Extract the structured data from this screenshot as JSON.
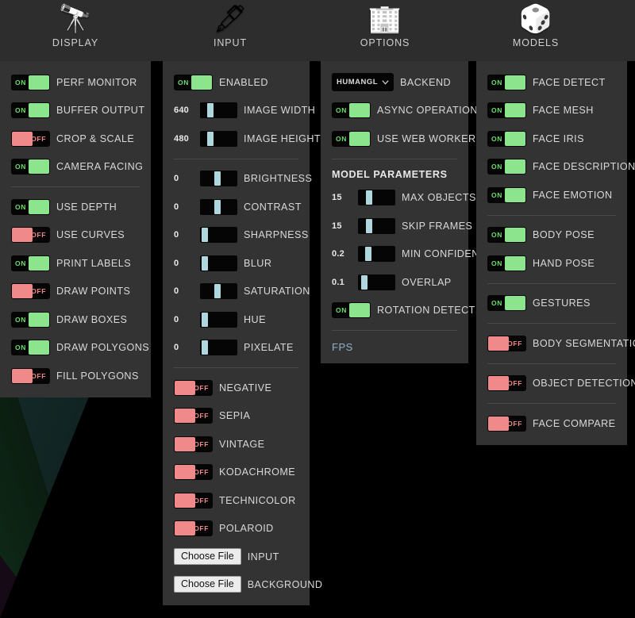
{
  "columns": [
    {
      "id": "display",
      "title": "DISPLAY",
      "icon": "binoculars-icon",
      "icon_glyph": "🔭",
      "rows": [
        {
          "type": "toggle",
          "label": "PERF MONITOR",
          "state": "ON",
          "state_label": "ON"
        },
        {
          "type": "toggle",
          "label": "BUFFER OUTPUT",
          "state": "ON",
          "state_label": "ON"
        },
        {
          "type": "toggle",
          "label": "CROP & SCALE",
          "state": "OFF",
          "state_label": "OFF"
        },
        {
          "type": "toggle",
          "label": "CAMERA FACING",
          "state": "ON",
          "state_label": "ON"
        },
        {
          "type": "divider"
        },
        {
          "type": "toggle",
          "label": "USE DEPTH",
          "state": "ON",
          "state_label": "ON"
        },
        {
          "type": "toggle",
          "label": "USE CURVES",
          "state": "OFF",
          "state_label": "OFF"
        },
        {
          "type": "toggle",
          "label": "PRINT LABELS",
          "state": "ON",
          "state_label": "ON"
        },
        {
          "type": "toggle",
          "label": "DRAW POINTS",
          "state": "OFF",
          "state_label": "OFF"
        },
        {
          "type": "toggle",
          "label": "DRAW BOXES",
          "state": "ON",
          "state_label": "ON"
        },
        {
          "type": "toggle",
          "label": "DRAW POLYGONS",
          "state": "ON",
          "state_label": "ON"
        },
        {
          "type": "toggle",
          "label": "FILL POLYGONS",
          "state": "OFF",
          "state_label": "OFF"
        }
      ]
    },
    {
      "id": "input",
      "title": "INPUT",
      "icon": "knives-icon",
      "icon_glyph": "🖋",
      "rows": [
        {
          "type": "toggle",
          "label": "ENABLED",
          "state": "ON",
          "state_label": "ON"
        },
        {
          "type": "slider",
          "label": "IMAGE WIDTH",
          "value": "640",
          "percent": 22
        },
        {
          "type": "slider",
          "label": "IMAGE HEIGHT",
          "value": "480",
          "percent": 22
        },
        {
          "type": "divider"
        },
        {
          "type": "slider",
          "label": "BRIGHTNESS",
          "value": "0",
          "percent": 47
        },
        {
          "type": "slider",
          "label": "CONTRAST",
          "value": "0",
          "percent": 47
        },
        {
          "type": "slider",
          "label": "SHARPNESS",
          "value": "0",
          "percent": 5
        },
        {
          "type": "slider",
          "label": "BLUR",
          "value": "0",
          "percent": 5
        },
        {
          "type": "slider",
          "label": "SATURATION",
          "value": "0",
          "percent": 47
        },
        {
          "type": "slider",
          "label": "HUE",
          "value": "0",
          "percent": 5
        },
        {
          "type": "slider",
          "label": "PIXELATE",
          "value": "0",
          "percent": 5
        },
        {
          "type": "divider"
        },
        {
          "type": "toggle",
          "label": "NEGATIVE",
          "state": "OFF",
          "state_label": "OFF"
        },
        {
          "type": "toggle",
          "label": "SEPIA",
          "state": "OFF",
          "state_label": "OFF"
        },
        {
          "type": "toggle",
          "label": "VINTAGE",
          "state": "OFF",
          "state_label": "OFF"
        },
        {
          "type": "toggle",
          "label": "KODACHROME",
          "state": "OFF",
          "state_label": "OFF"
        },
        {
          "type": "toggle",
          "label": "TECHNICOLOR",
          "state": "OFF",
          "state_label": "OFF"
        },
        {
          "type": "toggle",
          "label": "POLAROID",
          "state": "OFF",
          "state_label": "OFF"
        },
        {
          "type": "file",
          "label": "INPUT",
          "button": "Choose File"
        },
        {
          "type": "file",
          "label": "BACKGROUND",
          "button": "Choose File"
        }
      ]
    },
    {
      "id": "options",
      "title": "OPTIONS",
      "icon": "buildings-icon",
      "icon_glyph": "🏢",
      "rows": [
        {
          "type": "select",
          "label": "BACKEND",
          "value": "HUMANGL"
        },
        {
          "type": "toggle",
          "label": "ASYNC OPERATIONS",
          "state": "ON",
          "state_label": "ON"
        },
        {
          "type": "toggle",
          "label": "USE WEB WORKER",
          "state": "ON",
          "state_label": "ON"
        },
        {
          "type": "divider"
        },
        {
          "type": "heading",
          "label": "MODEL PARAMETERS"
        },
        {
          "type": "slider",
          "label": "MAX OBJECTS",
          "value": "15",
          "percent": 25
        },
        {
          "type": "slider",
          "label": "SKIP FRAMES",
          "value": "15",
          "percent": 25
        },
        {
          "type": "slider",
          "label": "MIN CONFIDENCE",
          "value": "0.2",
          "percent": 23
        },
        {
          "type": "slider",
          "label": "OVERLAP",
          "value": "0.1",
          "percent": 9
        },
        {
          "type": "toggle",
          "label": "ROTATION DETECTION",
          "state": "ON",
          "state_label": "ON"
        },
        {
          "type": "divider"
        },
        {
          "type": "fps",
          "label": "FPS"
        }
      ]
    },
    {
      "id": "models",
      "title": "MODELS",
      "icon": "dice-icon",
      "icon_glyph": "🎲",
      "rows": [
        {
          "type": "toggle",
          "label": "FACE DETECT",
          "state": "ON",
          "state_label": "ON"
        },
        {
          "type": "toggle",
          "label": "FACE MESH",
          "state": "ON",
          "state_label": "ON"
        },
        {
          "type": "toggle",
          "label": "FACE IRIS",
          "state": "ON",
          "state_label": "ON"
        },
        {
          "type": "toggle",
          "label": "FACE DESCRIPTION",
          "state": "ON",
          "state_label": "ON"
        },
        {
          "type": "toggle",
          "label": "FACE EMOTION",
          "state": "ON",
          "state_label": "ON"
        },
        {
          "type": "divider"
        },
        {
          "type": "toggle",
          "label": "BODY POSE",
          "state": "ON",
          "state_label": "ON"
        },
        {
          "type": "toggle",
          "label": "HAND POSE",
          "state": "ON",
          "state_label": "ON"
        },
        {
          "type": "divider"
        },
        {
          "type": "toggle",
          "label": "GESTURES",
          "state": "ON",
          "state_label": "ON"
        },
        {
          "type": "divider"
        },
        {
          "type": "toggle",
          "label": "BODY SEGMENTATION",
          "state": "OFF",
          "state_label": "OFF"
        },
        {
          "type": "divider"
        },
        {
          "type": "toggle",
          "label": "OBJECT DETECTION",
          "state": "OFF",
          "state_label": "OFF"
        },
        {
          "type": "divider"
        },
        {
          "type": "toggle",
          "label": "FACE COMPARE",
          "state": "OFF",
          "state_label": "OFF"
        }
      ]
    }
  ],
  "colors": {
    "panel_bg": "#333333",
    "header_bg": "#2d2d2d",
    "toggle_track": "#050505",
    "on_green": "#8ce58c",
    "off_red": "#f08a8a",
    "slider_thumb": "#aed7de",
    "label_text": "#d8d8d8",
    "fps_text": "#8fb3cc",
    "page_bg": "#000000"
  }
}
